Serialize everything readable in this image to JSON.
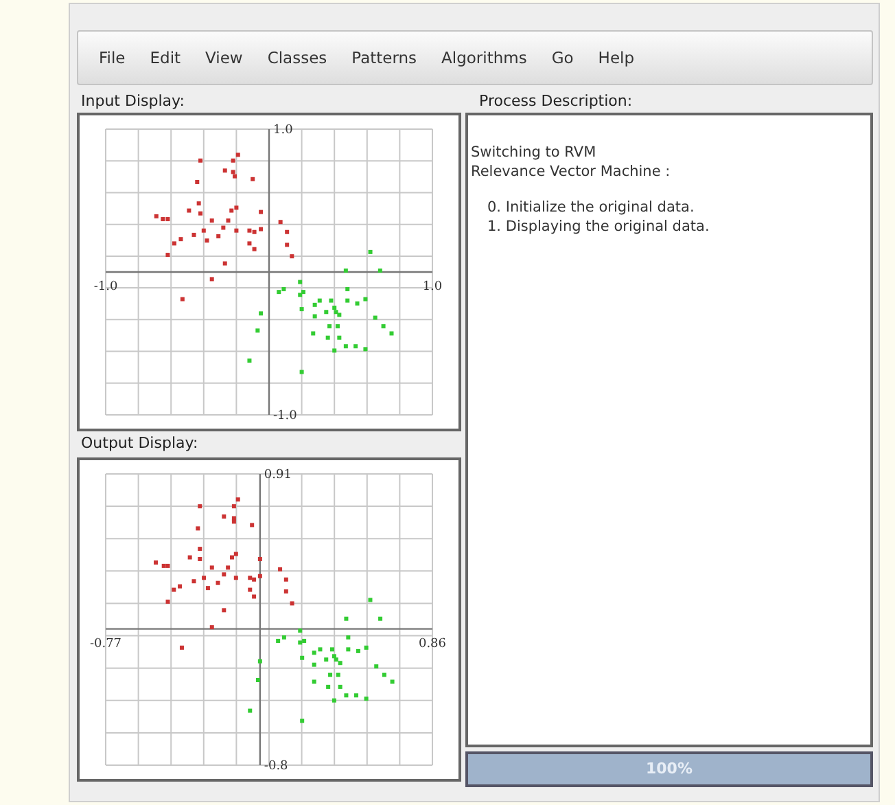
{
  "menu": [
    "File",
    "Edit",
    "View",
    "Classes",
    "Patterns",
    "Algorithms",
    "Go",
    "Help"
  ],
  "input_display": {
    "label": "Input Display:",
    "chart_data": {
      "type": "scatter",
      "xlim": [
        -1,
        1
      ],
      "ylim": [
        -1,
        1
      ],
      "xticks": [
        {
          "value": -1,
          "label": "-1.0"
        },
        {
          "value": 1,
          "label": "1.0"
        }
      ],
      "yticks": [
        {
          "value": -1,
          "label": "-1.0"
        },
        {
          "value": 1,
          "label": "1.0"
        }
      ],
      "series": [
        {
          "color": "#cc3333",
          "x": [
            -0.42,
            -0.22,
            -0.19,
            -0.27,
            -0.22,
            -0.21,
            -0.1,
            -0.44,
            -0.69,
            -0.65,
            -0.62,
            -0.49,
            -0.43,
            -0.42,
            -0.35,
            -0.23,
            -0.2,
            -0.05,
            0.07,
            0.11,
            -0.54,
            -0.58,
            -0.62,
            -0.46,
            -0.4,
            -0.38,
            -0.31,
            -0.28,
            -0.25,
            -0.2,
            -0.12,
            -0.09,
            -0.05,
            -0.12,
            -0.09,
            -0.27,
            -0.35,
            -0.53,
            0.11,
            0.14
          ],
          "values": [
            0.78,
            0.78,
            0.82,
            0.71,
            0.7,
            0.67,
            0.65,
            0.63,
            0.39,
            0.37,
            0.37,
            0.43,
            0.48,
            0.41,
            0.36,
            0.43,
            0.45,
            0.42,
            0.35,
            0.28,
            0.23,
            0.2,
            0.12,
            0.26,
            0.29,
            0.22,
            0.25,
            0.31,
            0.36,
            0.29,
            0.29,
            0.28,
            0.3,
            0.2,
            0.16,
            0.06,
            -0.05,
            -0.19,
            0.19,
            0.11
          ]
        },
        {
          "color": "#33cc33",
          "x": [
            0.62,
            0.68,
            0.47,
            0.48,
            0.06,
            0.09,
            0.19,
            0.19,
            0.21,
            0.2,
            -0.05,
            -0.07,
            -0.12,
            0.2,
            0.28,
            0.28,
            0.27,
            0.31,
            0.35,
            0.38,
            0.4,
            0.41,
            0.43,
            0.37,
            0.42,
            0.43,
            0.36,
            0.4,
            0.47,
            0.53,
            0.59,
            0.54,
            0.59,
            0.65,
            0.7,
            0.75,
            0.48
          ],
          "values": [
            0.14,
            0.01,
            0.01,
            -0.12,
            -0.14,
            -0.12,
            -0.07,
            -0.16,
            -0.14,
            -0.26,
            -0.29,
            -0.41,
            -0.62,
            -0.7,
            -0.23,
            -0.31,
            -0.43,
            -0.2,
            -0.28,
            -0.2,
            -0.25,
            -0.28,
            -0.3,
            -0.38,
            -0.38,
            -0.46,
            -0.46,
            -0.55,
            -0.52,
            -0.52,
            -0.54,
            -0.22,
            -0.19,
            -0.32,
            -0.38,
            -0.43,
            -0.2
          ]
        }
      ]
    }
  },
  "output_display": {
    "label": "Output Display:",
    "chart_data": {
      "type": "scatter",
      "xlim": [
        -0.77,
        0.86
      ],
      "ylim": [
        -0.8,
        0.91
      ],
      "xticks": [
        {
          "value": -0.77,
          "label": "-0.77"
        },
        {
          "value": 0.86,
          "label": "0.86"
        }
      ],
      "yticks": [
        {
          "value": -0.8,
          "label": "-0.8"
        },
        {
          "value": 0.91,
          "label": "0.91"
        }
      ],
      "series": [
        {
          "color": "#cc3333",
          "x": [
            -0.3,
            -0.13,
            -0.11,
            -0.18,
            -0.13,
            -0.13,
            -0.04,
            -0.31,
            -0.52,
            -0.48,
            -0.46,
            -0.35,
            -0.3,
            -0.3,
            -0.24,
            -0.14,
            -0.12,
            0.0,
            0.1,
            0.13,
            -0.4,
            -0.43,
            -0.46,
            -0.33,
            -0.28,
            -0.26,
            -0.21,
            -0.18,
            -0.16,
            -0.12,
            -0.05,
            -0.03,
            0.0,
            -0.05,
            -0.03,
            -0.18,
            -0.24,
            -0.39,
            0.13,
            0.16
          ],
          "values": [
            0.72,
            0.72,
            0.76,
            0.66,
            0.65,
            0.63,
            0.61,
            0.59,
            0.39,
            0.37,
            0.37,
            0.42,
            0.47,
            0.41,
            0.36,
            0.42,
            0.44,
            0.41,
            0.35,
            0.29,
            0.25,
            0.23,
            0.16,
            0.28,
            0.3,
            0.24,
            0.27,
            0.32,
            0.36,
            0.3,
            0.3,
            0.29,
            0.31,
            0.23,
            0.19,
            0.11,
            0.01,
            -0.11,
            0.22,
            0.15
          ]
        },
        {
          "color": "#33cc33",
          "x": [
            0.55,
            0.6,
            0.43,
            0.44,
            0.09,
            0.12,
            0.2,
            0.2,
            0.22,
            0.21,
            0.0,
            -0.01,
            -0.05,
            0.21,
            0.27,
            0.27,
            0.27,
            0.3,
            0.33,
            0.36,
            0.37,
            0.38,
            0.4,
            0.35,
            0.39,
            0.4,
            0.34,
            0.37,
            0.43,
            0.48,
            0.53,
            0.49,
            0.53,
            0.58,
            0.62,
            0.66,
            0.44
          ],
          "values": [
            0.17,
            0.06,
            0.06,
            -0.05,
            -0.07,
            -0.05,
            -0.01,
            -0.08,
            -0.07,
            -0.17,
            -0.19,
            -0.3,
            -0.48,
            -0.54,
            -0.14,
            -0.21,
            -0.31,
            -0.12,
            -0.18,
            -0.12,
            -0.16,
            -0.18,
            -0.2,
            -0.27,
            -0.27,
            -0.34,
            -0.34,
            -0.42,
            -0.39,
            -0.39,
            -0.41,
            -0.13,
            -0.11,
            -0.22,
            -0.27,
            -0.31,
            -0.12
          ]
        }
      ]
    }
  },
  "process_description": {
    "label": "Process Description:",
    "lines": [
      {
        "text": "Switching to RVM",
        "indent": false
      },
      {
        "text": "Relevance Vector Machine :",
        "indent": false
      },
      {
        "text": "0. Initialize the original data.",
        "indent": true
      },
      {
        "text": "1. Displaying the original data.",
        "indent": true
      }
    ]
  },
  "progress": {
    "level": 1,
    "text": "100%"
  }
}
